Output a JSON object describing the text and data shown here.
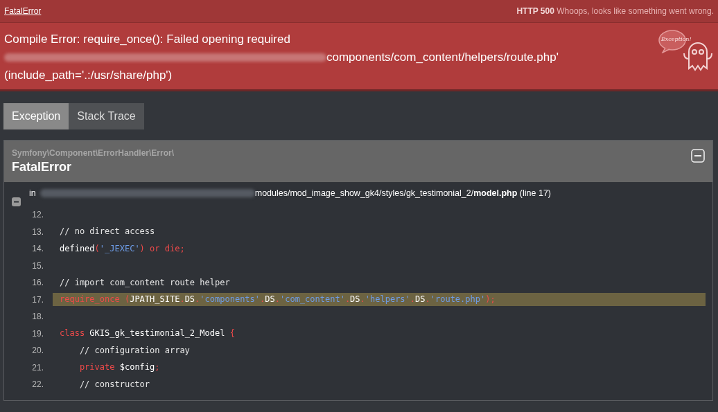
{
  "header": {
    "exception_link": "FatalError",
    "status_code": "HTTP 500",
    "status_message": "Whoops, looks like something went wrong."
  },
  "error": {
    "line_1": "Compile Error: require_once(): Failed opening required",
    "line_2": "components/com_content/helpers/route.php'",
    "line_3": "(include_path='.:/usr/share/php')",
    "mascot_bubble": "Exception!"
  },
  "tabs": [
    {
      "label": "Exception",
      "selected": true
    },
    {
      "label": "Stack Trace",
      "selected": false
    }
  ],
  "exception": {
    "namespace": "Symfony\\Component\\ErrorHandler\\Error\\",
    "class": "FatalError",
    "expanded": true,
    "location": {
      "prefix": "in",
      "path": "modules/mod_image_show_gk4/styles/gk_testimonial_2/",
      "file": "model.php",
      "line": "(line 17)"
    },
    "code": [
      {
        "number": "12.",
        "highlighted": false
      },
      {
        "number": "13.",
        "highlighted": false,
        "tokens": [
          {
            "kind": "comment",
            "text": "// no direct access"
          }
        ]
      },
      {
        "number": "14.",
        "highlighted": false,
        "tokens": [
          {
            "kind": "plain",
            "text": "defined"
          },
          {
            "kind": "punct",
            "text": "("
          },
          {
            "kind": "string",
            "text": "'_JEXEC'"
          },
          {
            "kind": "punct",
            "text": ") or die;"
          }
        ]
      },
      {
        "number": "15.",
        "highlighted": false
      },
      {
        "number": "16.",
        "highlighted": false,
        "tokens": [
          {
            "kind": "comment",
            "text": "// import com_content route helper"
          }
        ]
      },
      {
        "number": "17.",
        "highlighted": true,
        "tokens": [
          {
            "kind": "keyword",
            "text": "require_once"
          },
          {
            "kind": "punct",
            "text": " ("
          },
          {
            "kind": "plain",
            "text": "JPATH_SITE"
          },
          {
            "kind": "punct",
            "text": "."
          },
          {
            "kind": "plain",
            "text": "DS"
          },
          {
            "kind": "punct",
            "text": "."
          },
          {
            "kind": "string",
            "text": "'components'"
          },
          {
            "kind": "punct",
            "text": "."
          },
          {
            "kind": "plain",
            "text": "DS"
          },
          {
            "kind": "punct",
            "text": "."
          },
          {
            "kind": "string",
            "text": "'com_content'"
          },
          {
            "kind": "punct",
            "text": "."
          },
          {
            "kind": "plain",
            "text": "DS"
          },
          {
            "kind": "punct",
            "text": "."
          },
          {
            "kind": "string",
            "text": "'helpers'"
          },
          {
            "kind": "punct",
            "text": "."
          },
          {
            "kind": "plain",
            "text": "DS"
          },
          {
            "kind": "punct",
            "text": "."
          },
          {
            "kind": "string",
            "text": "'route.php'"
          },
          {
            "kind": "punct",
            "text": ");"
          }
        ]
      },
      {
        "number": "18.",
        "highlighted": false
      },
      {
        "number": "19.",
        "highlighted": false,
        "tokens": [
          {
            "kind": "keyword",
            "text": "class "
          },
          {
            "kind": "plain",
            "text": "GKIS_gk_testimonial_2_Model "
          },
          {
            "kind": "punct",
            "text": "{"
          }
        ]
      },
      {
        "number": "20.",
        "highlighted": false,
        "tokens": [
          {
            "kind": "comment",
            "text": "    // configuration array"
          }
        ]
      },
      {
        "number": "21.",
        "highlighted": false,
        "tokens": [
          {
            "kind": "keyword",
            "text": "    private "
          },
          {
            "kind": "plain",
            "text": "$config"
          },
          {
            "kind": "punct",
            "text": ";"
          }
        ]
      },
      {
        "number": "22.",
        "highlighted": false,
        "tokens": [
          {
            "kind": "comment",
            "text": "    // constructor"
          }
        ]
      }
    ]
  }
}
